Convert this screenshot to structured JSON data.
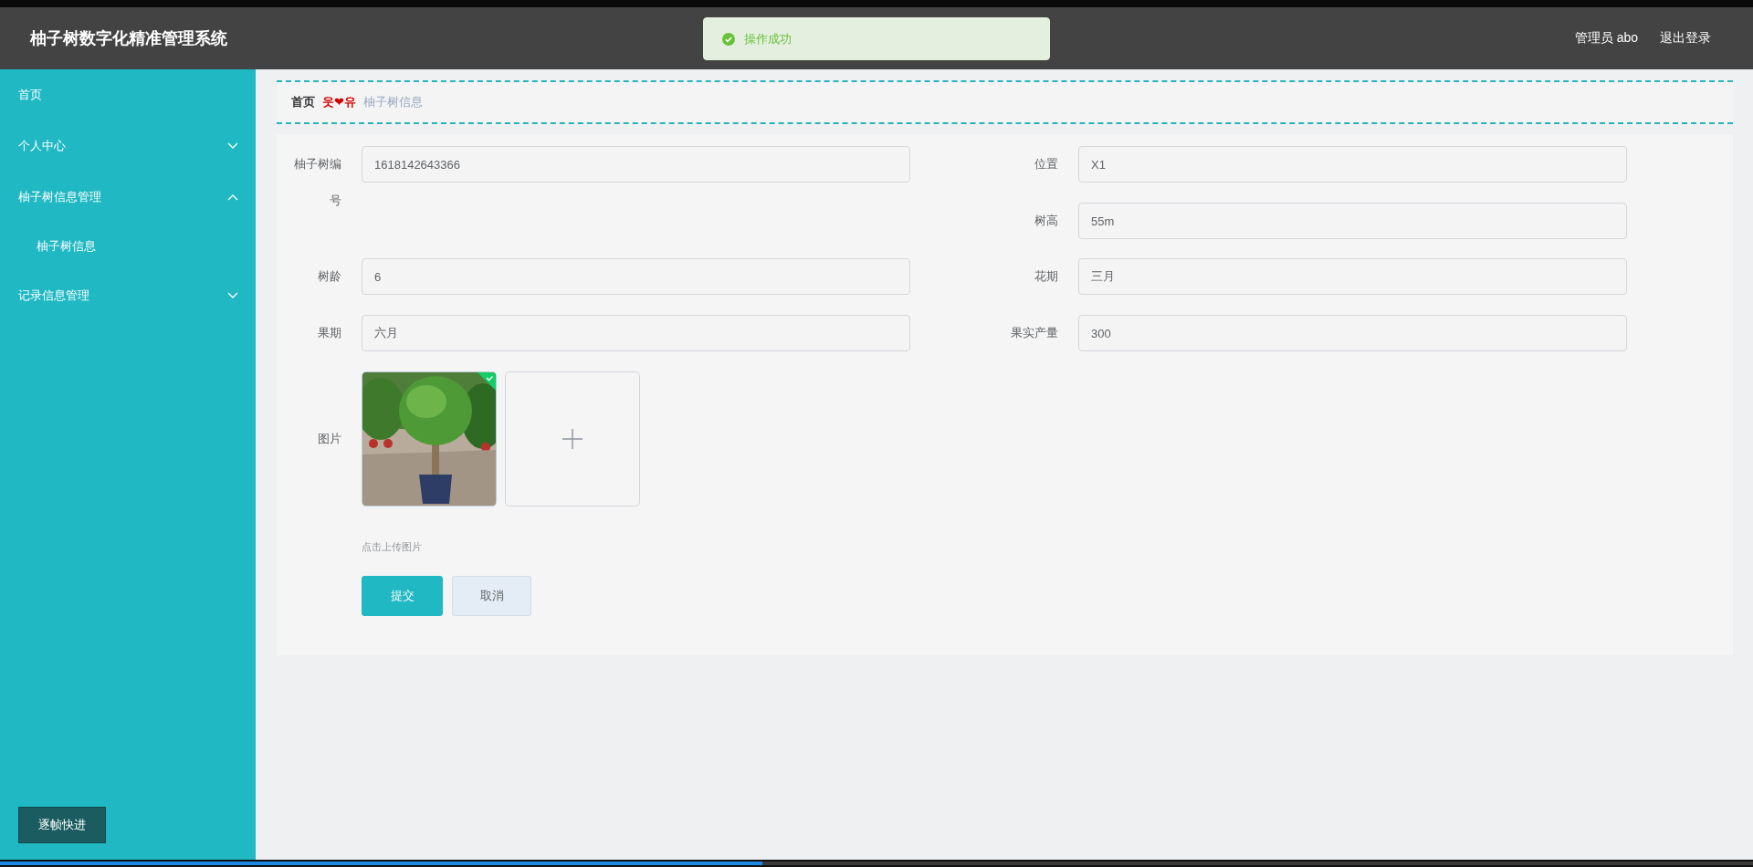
{
  "app": {
    "title": "柚子树数字化精准管理系统"
  },
  "header": {
    "user": "管理员 abo",
    "logout": "退出登录"
  },
  "toast": {
    "message": "操作成功",
    "kind": "success"
  },
  "sidebar": {
    "items": [
      {
        "label": "首页"
      },
      {
        "label": "个人中心",
        "expanded": false
      },
      {
        "label": "柚子树信息管理",
        "expanded": true,
        "children": [
          {
            "label": "柚子树信息"
          }
        ]
      },
      {
        "label": "记录信息管理",
        "expanded": false
      }
    ]
  },
  "breadcrumb": {
    "items": [
      "首页",
      "柚子树信息"
    ],
    "separator": "웃❤유"
  },
  "form": {
    "left": [
      {
        "label": "柚子树编号",
        "value": "1618142643366"
      },
      {
        "label": "树龄",
        "value": "6"
      },
      {
        "label": "果期",
        "value": "六月"
      }
    ],
    "right": [
      {
        "label": "位置",
        "value": "X1"
      },
      {
        "label": "树高",
        "value": "55m"
      },
      {
        "label": "花期",
        "value": "三月"
      },
      {
        "label": "果实产量",
        "value": "300"
      }
    ],
    "image_field": {
      "label": "图片",
      "hint": "点击上传图片",
      "files": [
        {
          "kind": "picture",
          "success": true
        }
      ]
    },
    "buttons": [
      {
        "label": "提交",
        "kind": "primary"
      },
      {
        "label": "取消",
        "kind": "default"
      }
    ]
  },
  "player": {
    "button": "逐帧快进",
    "level": 0.435
  }
}
